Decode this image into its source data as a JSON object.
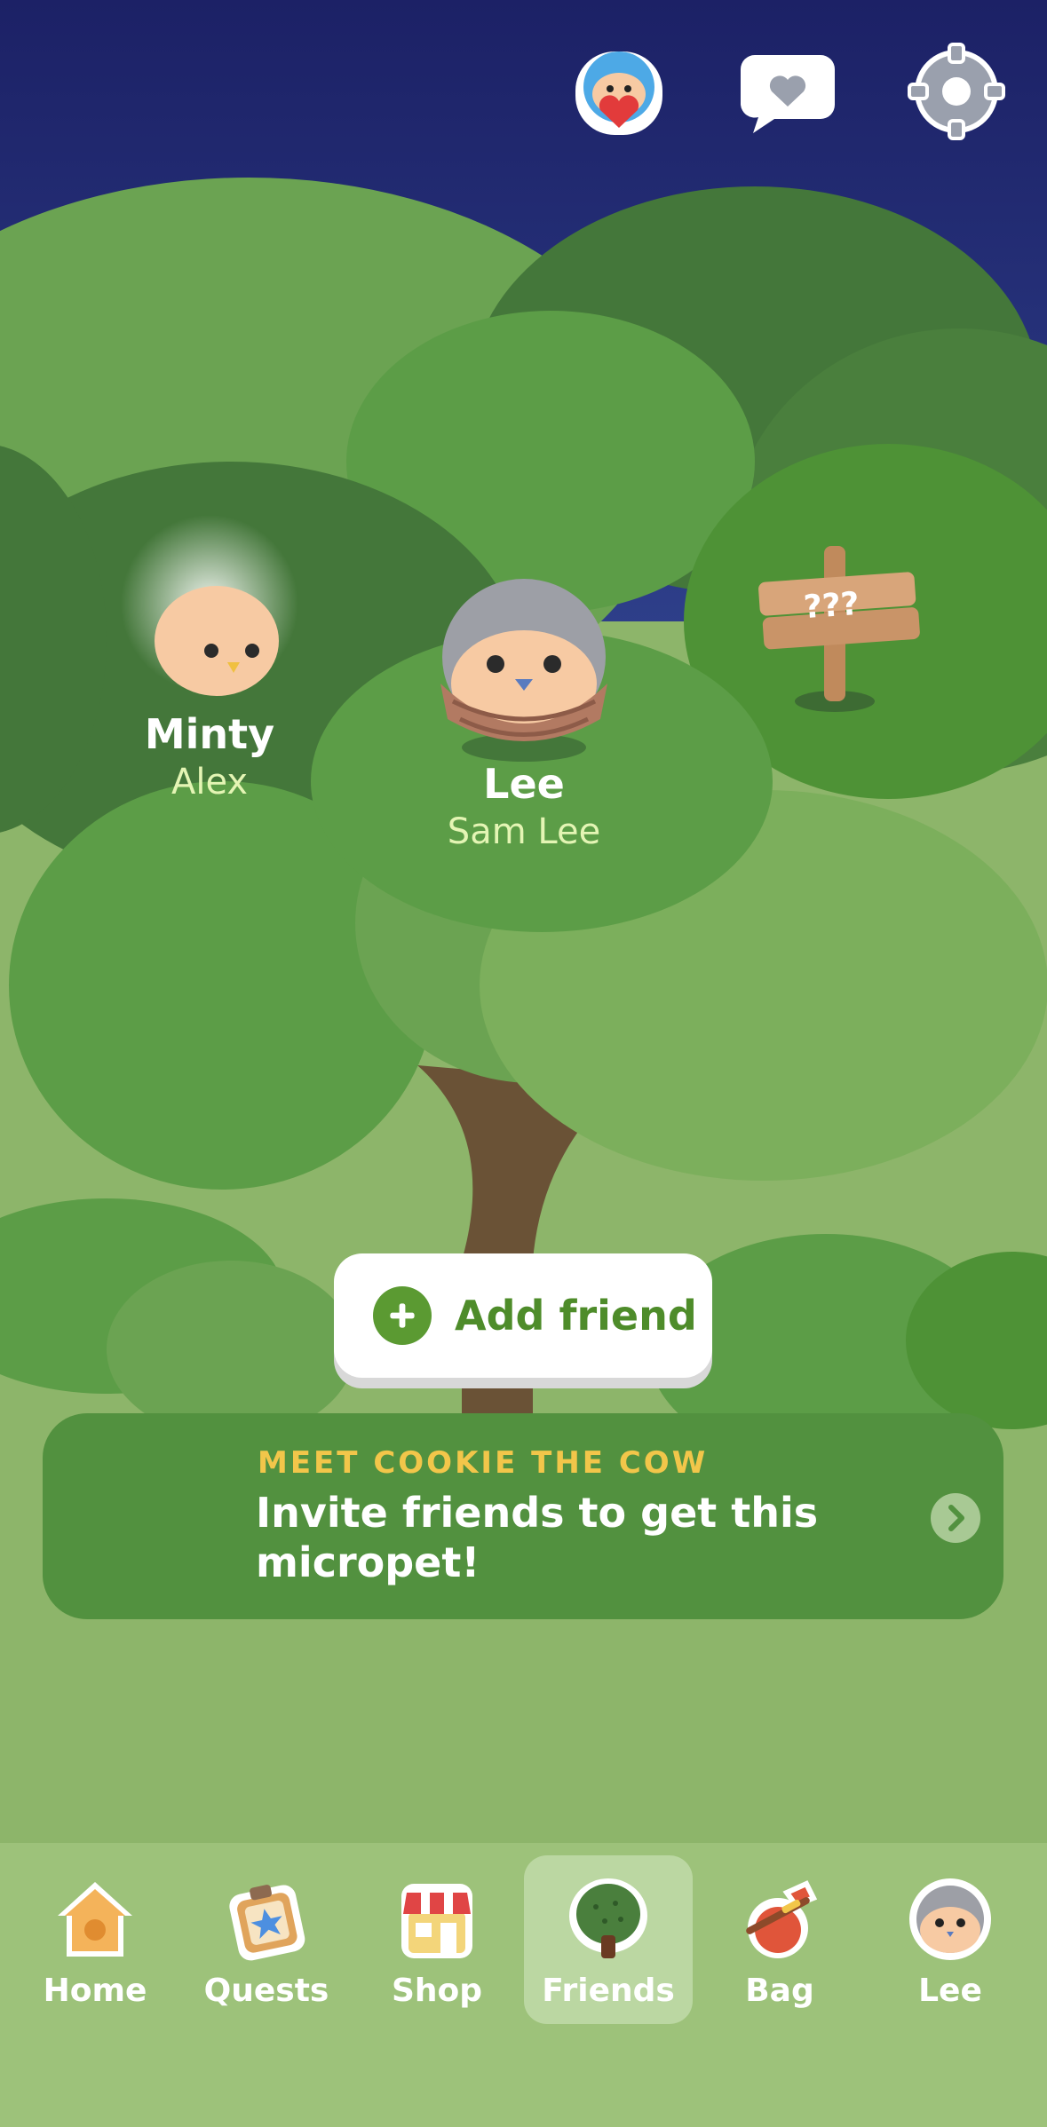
{
  "header": {
    "buttons": [
      {
        "icon": "mascot-heart-icon"
      },
      {
        "icon": "chat-heart-icon"
      },
      {
        "icon": "gear-icon"
      }
    ]
  },
  "friends": [
    {
      "pet_name": "Minty",
      "owner_name": "Alex"
    },
    {
      "pet_name": "Lee",
      "owner_name": "Sam Lee"
    }
  ],
  "signpost": {
    "text": "???"
  },
  "add_friend": {
    "label": "Add friend",
    "icon": "plus-icon"
  },
  "promo": {
    "kicker": "MEET COOKIE THE COW",
    "body": "Invite friends to get this micropet!",
    "icon": "cow-icon"
  },
  "nav": {
    "items": [
      {
        "label": "Home",
        "icon": "birdhouse-icon"
      },
      {
        "label": "Quests",
        "icon": "quest-board-icon"
      },
      {
        "label": "Shop",
        "icon": "shop-icon"
      },
      {
        "label": "Friends",
        "icon": "tree-icon",
        "active": true
      },
      {
        "label": "Bag",
        "icon": "bag-icon"
      },
      {
        "label": "Lee",
        "icon": "avatar-icon"
      }
    ]
  },
  "colors": {
    "sky_top": "#1c2166",
    "sky_bottom": "#2e3f8a",
    "foliage_dark": "#44773a",
    "foliage_mid": "#5c9d47",
    "foliage_light": "#7caf5c",
    "ground": "#8db56a",
    "accent_green": "#5b9a32",
    "kicker_yellow": "#f2c64a"
  }
}
